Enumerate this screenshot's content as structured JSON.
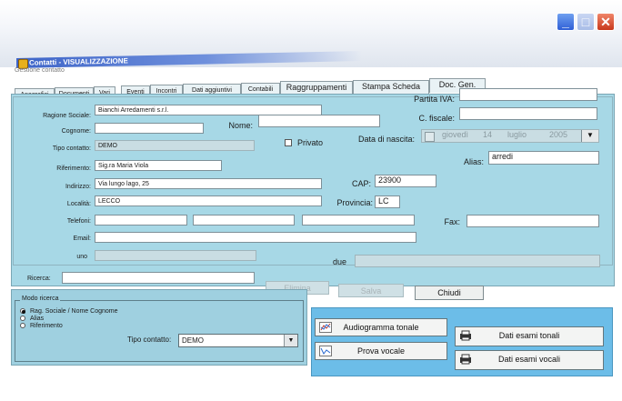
{
  "window": {
    "title": "Contatti - VISUALIZZAZIONE",
    "subtitle": "Gestione contatto",
    "min_symbol": "_",
    "max_symbol": "□",
    "close_symbol": "✕"
  },
  "tabs": [
    {
      "label": "Anagrafici",
      "active": true
    },
    {
      "label": "Documenti"
    },
    {
      "label": "Vari"
    },
    {
      "label": "Eventi"
    },
    {
      "label": "Incontri"
    },
    {
      "label": "Dati aggiuntivi"
    },
    {
      "label": "Contabili"
    },
    {
      "label": "Raggruppamenti"
    },
    {
      "label": "Stampa Scheda"
    },
    {
      "label": "Doc. Gen."
    }
  ],
  "form": {
    "partita_iva_label": "Partita IVA:",
    "partita_iva_value": "",
    "ragione_sociale_label": "Ragione Sociale:",
    "ragione_sociale_value": "Bianchi Arredamenti s.r.l.",
    "cfiscale_label": "C. fiscale:",
    "cfiscale_value": "",
    "cognome_label": "Cognome:",
    "cognome_value": "",
    "nome_label": "Nome:",
    "nome_value": "",
    "tipo_contatto_label": "Tipo contatto:",
    "tipo_contatto_value": "DEMO",
    "privato_label": "Privato",
    "data_nascita_label": "Data di nascita:",
    "data_nascita_day": "giovedì",
    "data_nascita_num": "14",
    "data_nascita_month": "luglio",
    "data_nascita_year": "2005",
    "alias_label": "Alias:",
    "alias_value": "arredi",
    "riferimento_label": "Riferimento:",
    "riferimento_value": "Sig.ra Maria Viola",
    "indirizzo_label": "Indirizzo:",
    "indirizzo_value": "Via lungo lago, 25",
    "cap_label": "CAP:",
    "cap_value": "23900",
    "localita_label": "Località:",
    "localita_value": "LECCO",
    "provincia_label": "Provincia:",
    "provincia_value": "LC",
    "telefoni_label": "Telefoni:",
    "fax_label": "Fax:",
    "email_label": "Email:",
    "uno_label": "uno",
    "due_label": "due"
  },
  "search": {
    "label": "Ricerca:",
    "value": ""
  },
  "actions": {
    "elimina": "Elimina",
    "salva": "Salva",
    "chiudi": "Chiudi"
  },
  "modo_ricerca": {
    "legend": "Modo ricerca",
    "options": [
      "Rag. Sociale / Nome Cognome",
      "Alias",
      "Riferimento"
    ],
    "selected": 0,
    "tipo_contatto_label": "Tipo contatto:",
    "tipo_contatto_value": "DEMO"
  },
  "tools": {
    "audiogramma": "Audiogramma tonale",
    "prova_vocale": "Prova vocale",
    "esami_tonali": "Dati esami tonali",
    "esami_vocali": "Dati esami vocali"
  }
}
